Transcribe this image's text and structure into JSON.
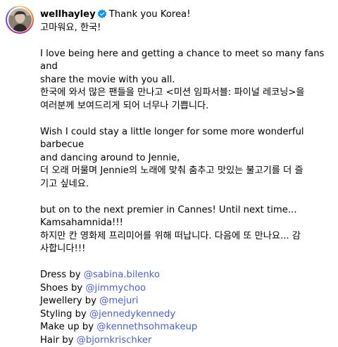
{
  "post": {
    "username": "wellhayley",
    "verified": true,
    "colors": {
      "mention": "#4a5fd0",
      "verified_badge": "#0095f6",
      "text": "#000000"
    },
    "title_en": "Thank you Korea!",
    "title_ko": "고마워요, 한국!",
    "para1_en_1": "I love being here and getting a chance to meet so many fans and",
    "para1_en_2": "share the movie with you all.",
    "para1_ko_1": "한국에 와서 많은 팬들을 만나고 <미션 임파서블: 파이널 레코닝>을",
    "para1_ko_2": "여러분께 보여드리게 되어 너무나 기쁩니다.",
    "para2_en_1": "Wish I could stay a little longer for some more wonderful barbecue",
    "para2_en_2": "and dancing around to Jennie,",
    "para2_ko_1": "더 오래 머물며 Jennie의 노래에 맞춰 춤추고 맛있는 불고기를 더 즐",
    "para2_ko_2": "기고 싶네요.",
    "para3_en_1": "but on to the next premier in Cannes! Until next time...",
    "para3_en_2": "Kamsahamnida!!!",
    "para3_ko_1": "하지만 칸 영화제 프리미어를 위해 떠납니다. 다음에 또 만나요... 감",
    "para3_ko_2": "사합니다!!!",
    "credits": [
      {
        "prefix": "Dress by ",
        "mention": "@sabina.bilenko"
      },
      {
        "prefix": "Shoes by ",
        "mention": "@jimmychoo"
      },
      {
        "prefix": "Jewellery by ",
        "mention": "@mejuri"
      },
      {
        "prefix": "Styling by ",
        "mention": "@jennedykennedy"
      },
      {
        "prefix": "Make up by ",
        "mention": "@kennethsohmakeup"
      },
      {
        "prefix": "Hair by ",
        "mention": "@bjornkrischker"
      }
    ]
  }
}
